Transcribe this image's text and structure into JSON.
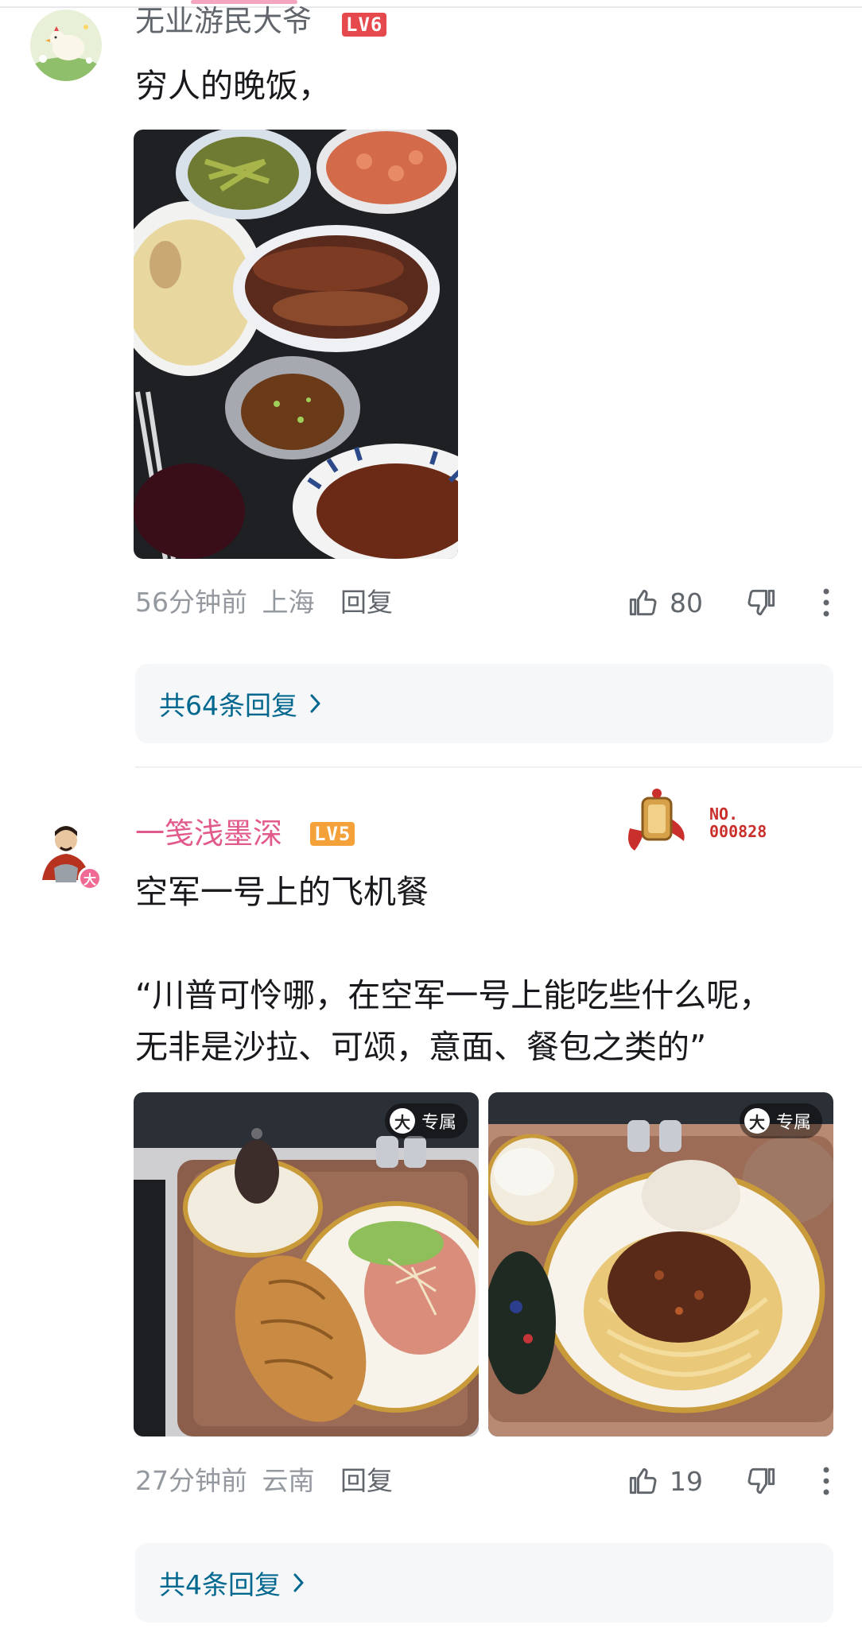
{
  "comments": [
    {
      "username": "无业游民大爷",
      "level": "LV6",
      "text": "穷人的晚饭，",
      "time": "56分钟前",
      "location": "上海",
      "reply_label": "回复",
      "likes": "80",
      "replies_label": "共64条回复",
      "name_color": "#61666d",
      "level_color": "#e5484d"
    },
    {
      "username": "一笺浅墨深",
      "level": "LV5",
      "badge_no_line1": "NO.",
      "badge_no_line2": "000828",
      "text_line1": "空军一号上的飞机餐",
      "text_line2": "“川普可怜哪，在空军一号上能吃些什么呢，",
      "text_line3": "无非是沙拉、可颂，意面、餐包之类的”",
      "image_tag": "专属",
      "image_tag_icon": "大",
      "avatar_badge": "大",
      "time": "27分钟前",
      "location": "云南",
      "reply_label": "回复",
      "likes": "19",
      "replies_label": "共4条回复",
      "name_color": "#e2598c",
      "level_color": "#f5a13a"
    }
  ]
}
